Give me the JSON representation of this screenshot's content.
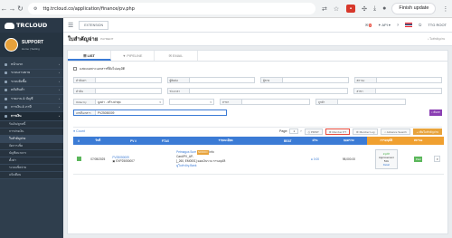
{
  "browser": {
    "url": "ttg.trcloud.co/application/finance/pv.php",
    "update_label": "Finish update"
  },
  "sidebar": {
    "brand": "TRCLOUD",
    "user_name": "SUPPORT",
    "user_sub": "Home | Setting",
    "items": [
      {
        "label": "หน้าแรก",
        "active": false,
        "sub": false
      },
      {
        "label": "ระบบงานขาย",
        "active": false,
        "sub": false
      },
      {
        "label": "ระบบจัดซื้อ",
        "active": false,
        "sub": false
      },
      {
        "label": "คลังสินค้า",
        "active": false,
        "sub": false
      },
      {
        "label": "รายงาน & บัญชี",
        "active": false,
        "sub": false
      },
      {
        "label": "การเงิน & ภาษี",
        "active": false,
        "sub": false
      },
      {
        "label": "การเงิน",
        "active": true,
        "sub": false
      },
      {
        "label": "รับเงิน/ลูกหนี้",
        "active": false,
        "sub": true
      },
      {
        "label": "การจ่ายเงิน",
        "active": false,
        "sub": true
      },
      {
        "label": "ใบสำคัญจ่าย",
        "active": false,
        "sub": true,
        "hl": true
      },
      {
        "label": "จัดการเช็ค",
        "active": false,
        "sub": true
      },
      {
        "label": "บัญชีธนาคาร",
        "active": false,
        "sub": true
      },
      {
        "label": "ตั้งค่า",
        "active": false,
        "sub": true
      },
      {
        "label": "ระบบเช็คจ่าย",
        "active": false,
        "sub": true
      },
      {
        "label": "แจ้งเตือน",
        "active": false,
        "sub": true
      }
    ]
  },
  "topbar": {
    "extension": "EXTENSION",
    "api": "API",
    "user": "TTG ROOT"
  },
  "header": {
    "title": "ใบสำคัญจ่าย",
    "subtitle": "PAYMENT",
    "breadcrumb": "ใบสำคัญจ่าย"
  },
  "tabs": [
    "LIST",
    "PIPELINE",
    "EMAIL"
  ],
  "form": {
    "checkbox_label": "แสดงเฉพาะเอกสารที่ยังไม่อนุมัติ",
    "row1": [
      {
        "label": "คำค้นหา",
        "value": ""
      },
      {
        "label": "ผู้ติดต่อ",
        "value": ""
      },
      {
        "label": "ผู้ขาย",
        "value": ""
      },
      {
        "label": "สถานะ",
        "value": ""
      }
    ],
    "row2": [
      {
        "label": "คำค้น",
        "value": ""
      },
      {
        "label": "ช่วงเวลา",
        "value": ""
      },
      {
        "label": "สาขา",
        "value": ""
      }
    ],
    "row3": [
      {
        "label": "Order by",
        "value": "มูลค่า - สร้างล่าสุด",
        "select": true
      },
      {
        "label": "",
        "value": "",
        "select": true
      },
      {
        "label": "สาขา",
        "value": ""
      },
      {
        "label": "ลูกค้า",
        "value": ""
      }
    ],
    "doc_label": "เลขที่เอกสาร",
    "doc_value": "PV25050009",
    "search_btn": "ค้นหา"
  },
  "toolbar": {
    "count_label": "Count",
    "page_label": "Page:",
    "page_value": "1",
    "buttons": [
      "PRINT",
      "Member PT",
      "Member Log",
      "Advance Search"
    ],
    "add_btn": "+ เพิ่มใบสำคัญจ่าย"
  },
  "table": {
    "headers": [
      "#",
      "วันที่",
      "PV #",
      "FTAX",
      "รายละเอียด",
      "BEAT",
      "ผ่าน",
      "ยอดรวม",
      "การอนุมัติ",
      "สถานะ",
      ""
    ],
    "row": {
      "date": "07/05/2025",
      "pv": "PV25050009",
      "ref": "EXP25050007",
      "ftax": "",
      "detail_1": "Petmagus Sure",
      "detail_badge": "SOOOO",
      "detail_info": "Info",
      "detail_2": "Card/PV_AP-",
      "detail_3": "[_260, EM0001]",
      "detail_4": "ยอดเงินรวม การอนุมัติ",
      "detail_link1": "ดูใบสำคัญ",
      "detail_link2": "Bank",
      "beat": "",
      "paid": "0.00",
      "total": "98,000.00",
      "approval_top": "อนุมัติ",
      "approval_mid": "Approvement",
      "approval_mid2": "รอน",
      "approval_detail": "Detail",
      "status": "Paid"
    }
  }
}
